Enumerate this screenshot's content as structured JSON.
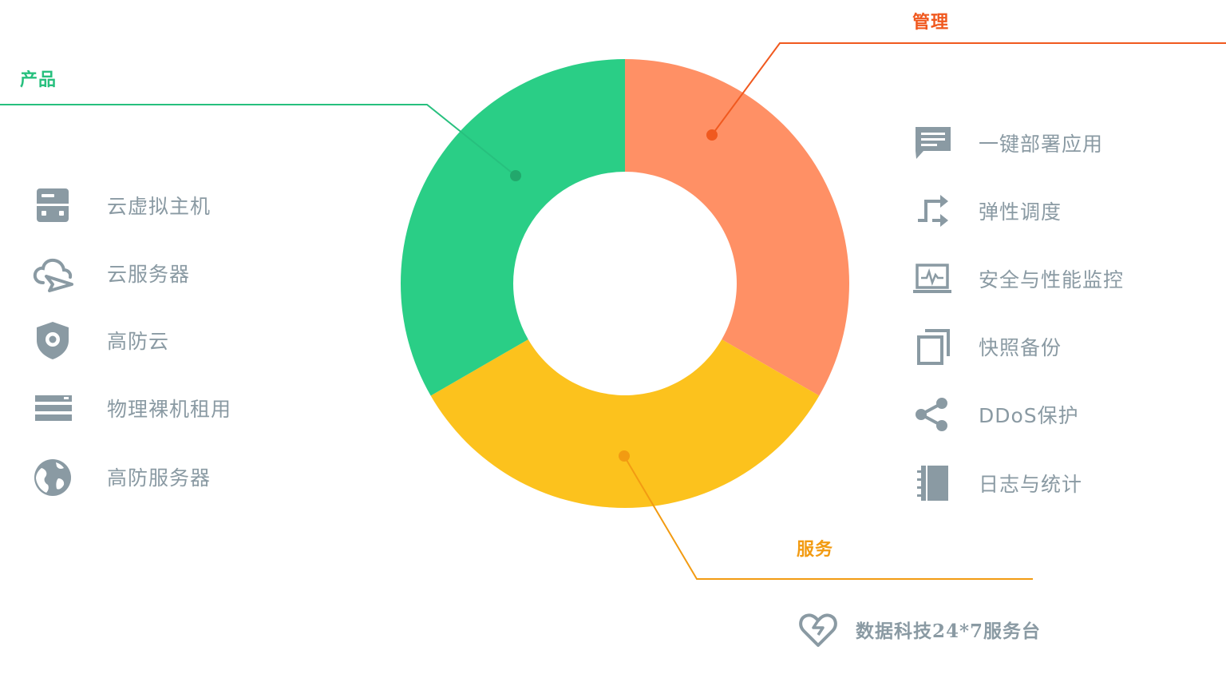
{
  "categories": {
    "product": {
      "label": "产品",
      "color": "#2ace86",
      "accent": "#27c07e"
    },
    "manage": {
      "label": "管理",
      "color": "#ff9065",
      "accent": "#f0591f"
    },
    "service": {
      "label": "服务",
      "color": "#fcc21d",
      "accent": "#f29b12"
    }
  },
  "product_items": [
    {
      "icon": "server-icon",
      "label": "云虚拟主机"
    },
    {
      "icon": "cloud-send-icon",
      "label": "云服务器"
    },
    {
      "icon": "shield-icon",
      "label": "高防云"
    },
    {
      "icon": "rack-server-icon",
      "label": "物理裸机租用"
    },
    {
      "icon": "globe-icon",
      "label": "高防服务器"
    }
  ],
  "manage_items": [
    {
      "icon": "message-icon",
      "label": "一键部署应用"
    },
    {
      "icon": "transfer-arrows-icon",
      "label": "弹性调度"
    },
    {
      "icon": "laptop-monitor-icon",
      "label": "安全与性能监控"
    },
    {
      "icon": "copy-icon",
      "label": "快照备份"
    },
    {
      "icon": "share-icon",
      "label": "DDoS保护"
    },
    {
      "icon": "notebook-icon",
      "label": "日志与统计"
    }
  ],
  "service_items": [
    {
      "icon": "heart-icon",
      "label": "数据科技24*7服务台"
    }
  ],
  "chart_data": {
    "type": "pie",
    "categories": [
      "管理",
      "服务",
      "产品"
    ],
    "values": [
      1,
      1,
      1
    ]
  },
  "icon_color": "#8a9aa3"
}
